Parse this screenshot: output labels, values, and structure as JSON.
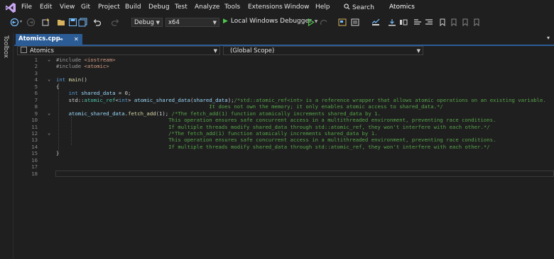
{
  "menu": [
    "File",
    "Edit",
    "View",
    "Git",
    "Project",
    "Build",
    "Debug",
    "Test",
    "Analyze",
    "Tools",
    "Extensions",
    "Window",
    "Help"
  ],
  "search_label": "Search",
  "app_title": "Atomics",
  "toolbar": {
    "config": "Debug",
    "platform": "x64",
    "run_label": "Local Windows Debugger"
  },
  "toolbox_label": "Toolbox",
  "tab": {
    "title": "Atomics.cpp"
  },
  "nav": {
    "project": "Atomics",
    "scope": "(Global Scope)"
  },
  "code_lines": [
    {
      "n": "1",
      "fold": "⌄",
      "parts": [
        [
          "pp",
          "#include "
        ],
        [
          "inc",
          "<iostream>"
        ]
      ]
    },
    {
      "n": "2",
      "fold": "",
      "parts": [
        [
          "pp",
          "#include "
        ],
        [
          "inc",
          "<atomic>"
        ]
      ]
    },
    {
      "n": "3",
      "fold": "",
      "parts": []
    },
    {
      "n": "4",
      "fold": "⌄",
      "parts": [
        [
          "kw",
          "int "
        ],
        [
          "fn",
          "main"
        ],
        [
          "",
          "()"
        ]
      ]
    },
    {
      "n": "5",
      "fold": "",
      "parts": [
        [
          "",
          "{"
        ]
      ]
    },
    {
      "n": "6",
      "fold": "",
      "parts": [
        [
          "",
          "    "
        ],
        [
          "kw",
          "int "
        ],
        [
          "var",
          "shared_data"
        ],
        [
          "",
          " = 0;"
        ]
      ]
    },
    {
      "n": "7",
      "fold": "",
      "parts": [
        [
          "",
          "    std::"
        ],
        [
          "ty",
          "atomic_ref"
        ],
        [
          "",
          "<"
        ],
        [
          "kw",
          "int"
        ],
        [
          "",
          "> "
        ],
        [
          "var",
          "atomic_shared_data"
        ],
        [
          "",
          "("
        ],
        [
          "var",
          "shared_data"
        ],
        [
          "",
          ");"
        ],
        [
          "cm",
          "/*std::atomic_ref<int> is a reference wrapper that allows atomic operations on an existing variable."
        ]
      ]
    },
    {
      "n": "8",
      "fold": "",
      "parts": [
        [
          "cm",
          "                                                 It does not own the memory; it only enables atomic access to shared_data.*/"
        ]
      ]
    },
    {
      "n": "9",
      "fold": "⌄",
      "parts": [
        [
          "",
          "    "
        ],
        [
          "var",
          "atomic_shared_data"
        ],
        [
          ".",
          ""
        ],
        [
          "",
          "."
        ],
        [
          "fn",
          "fetch_add"
        ],
        [
          "",
          "(1); "
        ],
        [
          "cm",
          "/*The fetch_add(1) function atomically increments shared_data by 1."
        ]
      ]
    },
    {
      "n": "10",
      "fold": "",
      "parts": [
        [
          "cm",
          "                                    This operation ensures safe concurrent access in a multithreaded environment, preventing race conditions."
        ]
      ]
    },
    {
      "n": "11",
      "fold": "",
      "parts": [
        [
          "cm",
          "                                    If multiple threads modify shared_data through std::atomic_ref, they won't interfere with each other.*/"
        ]
      ]
    },
    {
      "n": "12",
      "fold": "⌄",
      "parts": [
        [
          "cm",
          "                                    /*The fetch_add(1) function atomically increments shared_data by 1."
        ]
      ]
    },
    {
      "n": "13",
      "fold": "",
      "parts": [
        [
          "cm",
          "                                    This operation ensures safe concurrent access in a multithreaded environment, preventing race conditions."
        ]
      ]
    },
    {
      "n": "14",
      "fold": "",
      "parts": [
        [
          "cm",
          "                                    If multiple threads modify shared_data through std::atomic_ref, they won't interfere with each other.*/"
        ]
      ]
    },
    {
      "n": "15",
      "fold": "",
      "parts": [
        [
          "",
          "}"
        ]
      ]
    },
    {
      "n": "16",
      "fold": "",
      "parts": []
    },
    {
      "n": "17",
      "fold": "",
      "parts": []
    },
    {
      "n": "18",
      "fold": "",
      "parts": []
    }
  ]
}
